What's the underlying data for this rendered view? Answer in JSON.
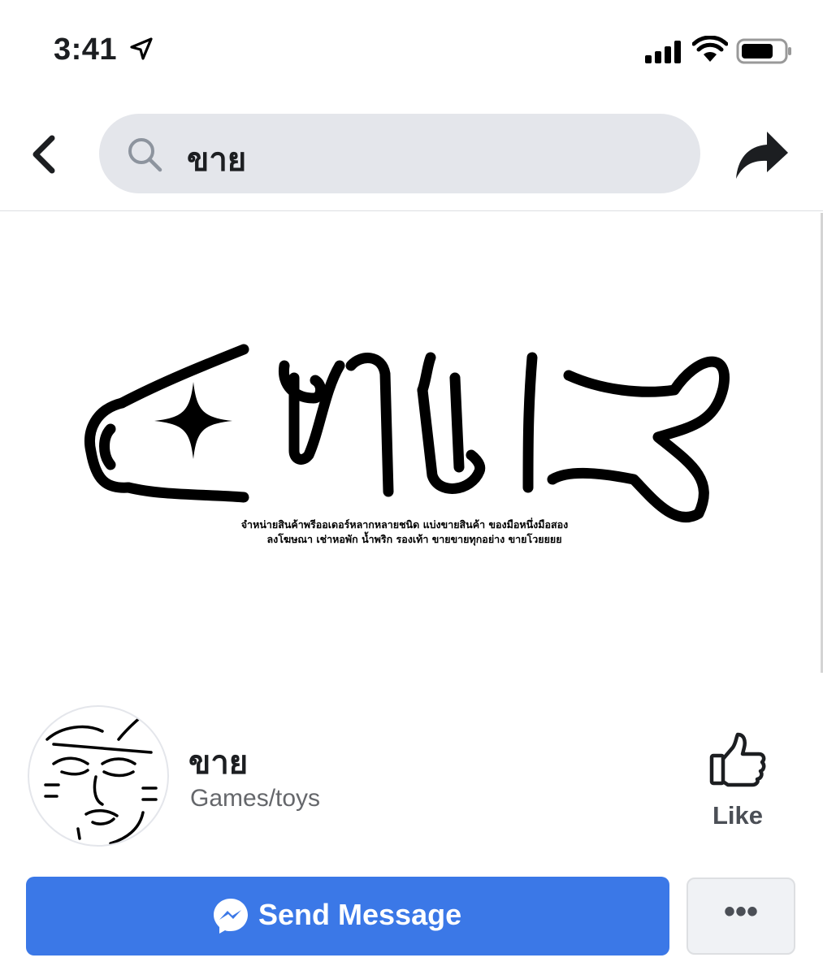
{
  "status_bar": {
    "time": "3:41",
    "location_icon": "location-arrow-icon",
    "signal_icon": "cellular-signal-icon",
    "wifi_icon": "wifi-icon",
    "battery_icon": "battery-icon"
  },
  "nav": {
    "back_icon": "chevron-left-icon",
    "search_icon": "search-icon",
    "search_query": "ขาย",
    "share_icon": "share-arrow-icon"
  },
  "cover": {
    "logo_text": "ขาย",
    "caption_line1": "จำหน่ายสินค้าพรีออเดอร์หลากหลายชนิด แบ่งขายสินค้า ของมือหนึ่งมือสอง",
    "caption_line2": "ลงโฆษณา เช่าหอพัก น้ำพริก รองเท้า ขายขายทุกอย่าง ขายโวยยยย"
  },
  "profile": {
    "avatar_icon": "meme-face-avatar",
    "page_name": "ขาย",
    "category": "Games/toys"
  },
  "like": {
    "label": "Like",
    "icon": "thumbs-up-icon"
  },
  "actions": {
    "send_message_label": "Send Message",
    "messenger_icon": "messenger-icon",
    "more_label": "•••"
  },
  "colors": {
    "primary_blue": "#3b78e7",
    "search_bg": "#e4e6eb",
    "secondary_text": "#65676b"
  }
}
